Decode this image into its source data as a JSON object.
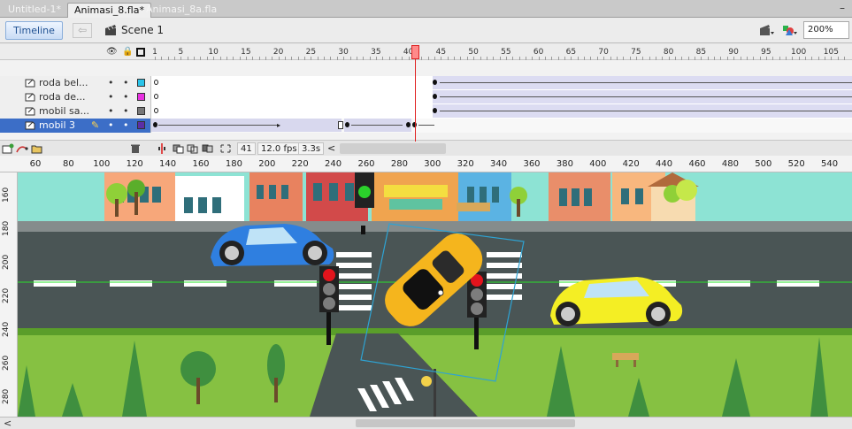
{
  "tabs": [
    {
      "label": "Untitled-1*",
      "active": false
    },
    {
      "label": "Animasi_8.fla*",
      "active": true
    },
    {
      "label": "Animasi_8a.fla",
      "active": false
    }
  ],
  "window": {
    "minimize_glyph": "–"
  },
  "editbar": {
    "timeline_label": "Timeline",
    "back_glyph": "⇦",
    "scene_label": "Scene 1",
    "zoom_value": "200%",
    "icons": [
      "scene-clapper-icon",
      "edit-symbols-icon",
      "edit-scene-icon"
    ]
  },
  "timeline": {
    "header_icons": [
      "eye-icon",
      "lock-icon",
      "outline-icon"
    ],
    "frame_numbers": [
      "1",
      "5",
      "10",
      "15",
      "20",
      "25",
      "30",
      "35",
      "40",
      "45",
      "50",
      "55",
      "60",
      "65",
      "70",
      "75",
      "80",
      "85",
      "90",
      "95",
      "100",
      "105"
    ],
    "current_frame": 41,
    "layers": [
      {
        "name": "roda bel...",
        "color": "#29c4ea",
        "selected": false
      },
      {
        "name": "roda de...",
        "color": "#e831e1",
        "selected": false
      },
      {
        "name": "mobil sa...",
        "color": "#777777",
        "selected": false
      },
      {
        "name": "mobil 3",
        "color": "#5b2ea6",
        "selected": true
      }
    ],
    "layer_dot": "•",
    "footer": {
      "frame": "41",
      "fps": "12.0 fps",
      "time": "3.3s",
      "scroll_left": "<"
    },
    "footer_icons": [
      "new-layer-icon",
      "motion-guide-icon",
      "new-folder-icon",
      "delete-layer-icon",
      "center-frame-icon",
      "onion-skin-icon",
      "onion-outline-icon",
      "edit-multiple-frames-icon",
      "modify-markers-icon"
    ]
  },
  "rulers": {
    "top": [
      "60",
      "80",
      "100",
      "120",
      "140",
      "160",
      "180",
      "200",
      "220",
      "240",
      "260",
      "280",
      "300",
      "320",
      "340",
      "360",
      "380",
      "400",
      "420",
      "440",
      "460",
      "480",
      "500",
      "520",
      "540",
      "5"
    ],
    "left": [
      "160",
      "180",
      "200",
      "220",
      "240",
      "260",
      "280",
      "300"
    ]
  },
  "scrollbar": {
    "left_arrow": "<"
  },
  "stage": {
    "colors": {
      "sky": "#8de3d4",
      "road": "#4a5555",
      "grass": "#86c142",
      "car_blue": "#2f7fe0",
      "car_yellow_tilted": "#f5b51d",
      "car_yellow": "#f4ee24",
      "traffic_red": "#e3141c",
      "traffic_green": "#2bd12b"
    }
  }
}
